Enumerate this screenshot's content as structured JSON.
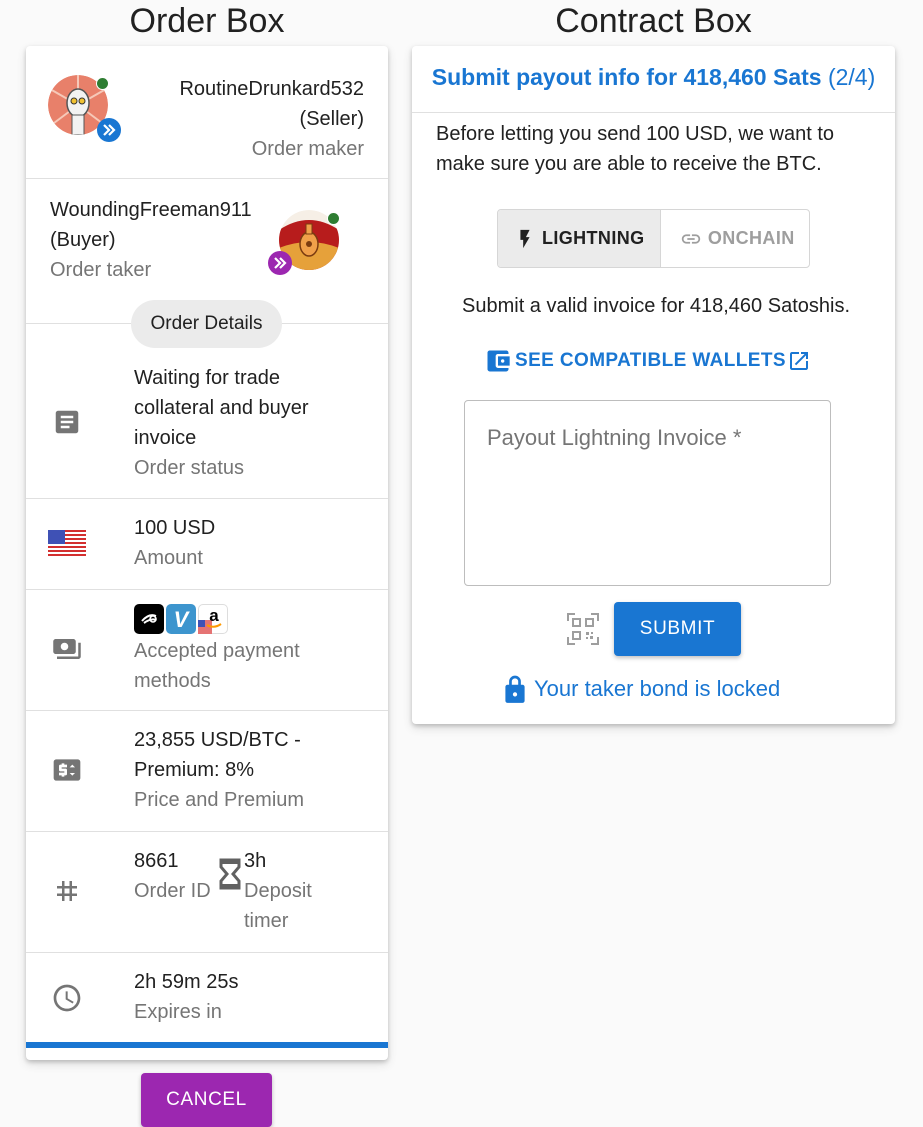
{
  "titles": {
    "order_box": "Order Box",
    "contract_box": "Contract Box"
  },
  "order": {
    "maker": {
      "name": "RoutineDrunkard532",
      "role": "(Seller)",
      "label": "Order maker"
    },
    "taker": {
      "name": "WoundingFreeman911",
      "role": "(Buyer)",
      "label": "Order taker"
    },
    "details_chip": "Order Details",
    "status": {
      "line1": "Waiting for trade",
      "line2": "collateral and buyer",
      "line3": "invoice",
      "label": "Order status"
    },
    "amount": {
      "value": "100 USD",
      "label": "Amount"
    },
    "payment": {
      "label_line1": "Accepted payment",
      "label_line2": "methods",
      "methods": [
        "cash-app",
        "venmo",
        "amazon-gift-card"
      ]
    },
    "price": {
      "line1": "23,855 USD/BTC -",
      "line2": "Premium: 8%",
      "label": "Price and Premium"
    },
    "order_id": {
      "value": "8661",
      "label": "Order ID"
    },
    "deposit_timer": {
      "value": "3h",
      "label_line1": "Deposit",
      "label_line2": "timer"
    },
    "expires": {
      "value": "2h 59m 25s",
      "label": "Expires in"
    },
    "progress_fraction": 1.0,
    "cancel_label": "CANCEL"
  },
  "contract": {
    "title": "Submit payout info for 418,460 Sats",
    "step": "(2/4)",
    "intro_line1": "Before letting you send 100 USD, we want to",
    "intro_line2": "make sure you are able to receive the BTC.",
    "toggle": {
      "lightning": "LIGHTNING",
      "onchain": "ONCHAIN",
      "selected": "lightning"
    },
    "instruction": "Submit a valid invoice for 418,460 Satoshis.",
    "wallets_link": "SEE COMPATIBLE WALLETS",
    "invoice_placeholder": "Payout Lightning Invoice *",
    "submit_label": "SUBMIT",
    "bond_status": "Your taker bond is locked"
  },
  "colors": {
    "primary": "#1976d2",
    "secondary": "#9c27b0",
    "online": "#2e7d32"
  }
}
